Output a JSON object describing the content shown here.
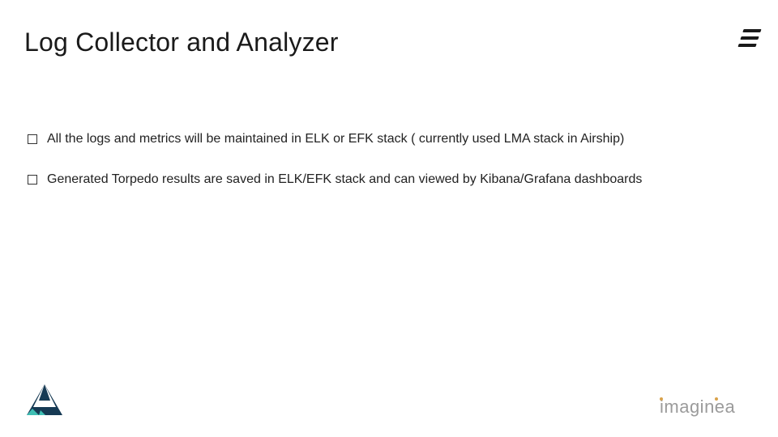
{
  "title": "Log Collector and Analyzer",
  "bullets": [
    "All the logs and metrics will be maintained in ELK or EFK stack ( currently used LMA stack in Airship)",
    "Generated Torpedo results are saved in ELK/EFK stack and can viewed by Kibana/Grafana dashboards"
  ],
  "top_right_logo_name": "ericsson-logo",
  "footer_left_logo_name": "airship-logo",
  "footer_right_logo_name": "imaginea-logo"
}
